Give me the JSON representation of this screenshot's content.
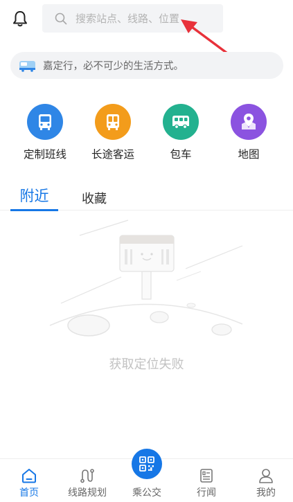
{
  "search": {
    "placeholder": "搜索站点、线路、位置"
  },
  "slogan": {
    "text": "嘉定行，必不可少的生活方式。"
  },
  "services": [
    {
      "label": "定制班线",
      "icon": "bus-icon",
      "color": "#2f86e6"
    },
    {
      "label": "长途客运",
      "icon": "coach-icon",
      "color": "#f39c1b"
    },
    {
      "label": "包车",
      "icon": "charter-van-icon",
      "color": "#23b18f"
    },
    {
      "label": "地图",
      "icon": "map-pin-icon",
      "color": "#8b53e0"
    }
  ],
  "tabs": [
    {
      "label": "附近",
      "active": true
    },
    {
      "label": "收藏",
      "active": false
    }
  ],
  "empty_state": {
    "text": "获取定位失败"
  },
  "bottom_nav": [
    {
      "label": "首页",
      "icon": "home-icon",
      "active": true
    },
    {
      "label": "线路规划",
      "icon": "route-icon",
      "active": false
    },
    {
      "label": "乘公交",
      "icon": "qr-code-icon",
      "active": false
    },
    {
      "label": "行闻",
      "icon": "news-icon",
      "active": false
    },
    {
      "label": "我的",
      "icon": "user-icon",
      "active": false
    }
  ],
  "colors": {
    "accent": "#1677e6",
    "annotation_arrow": "#e8313a"
  }
}
